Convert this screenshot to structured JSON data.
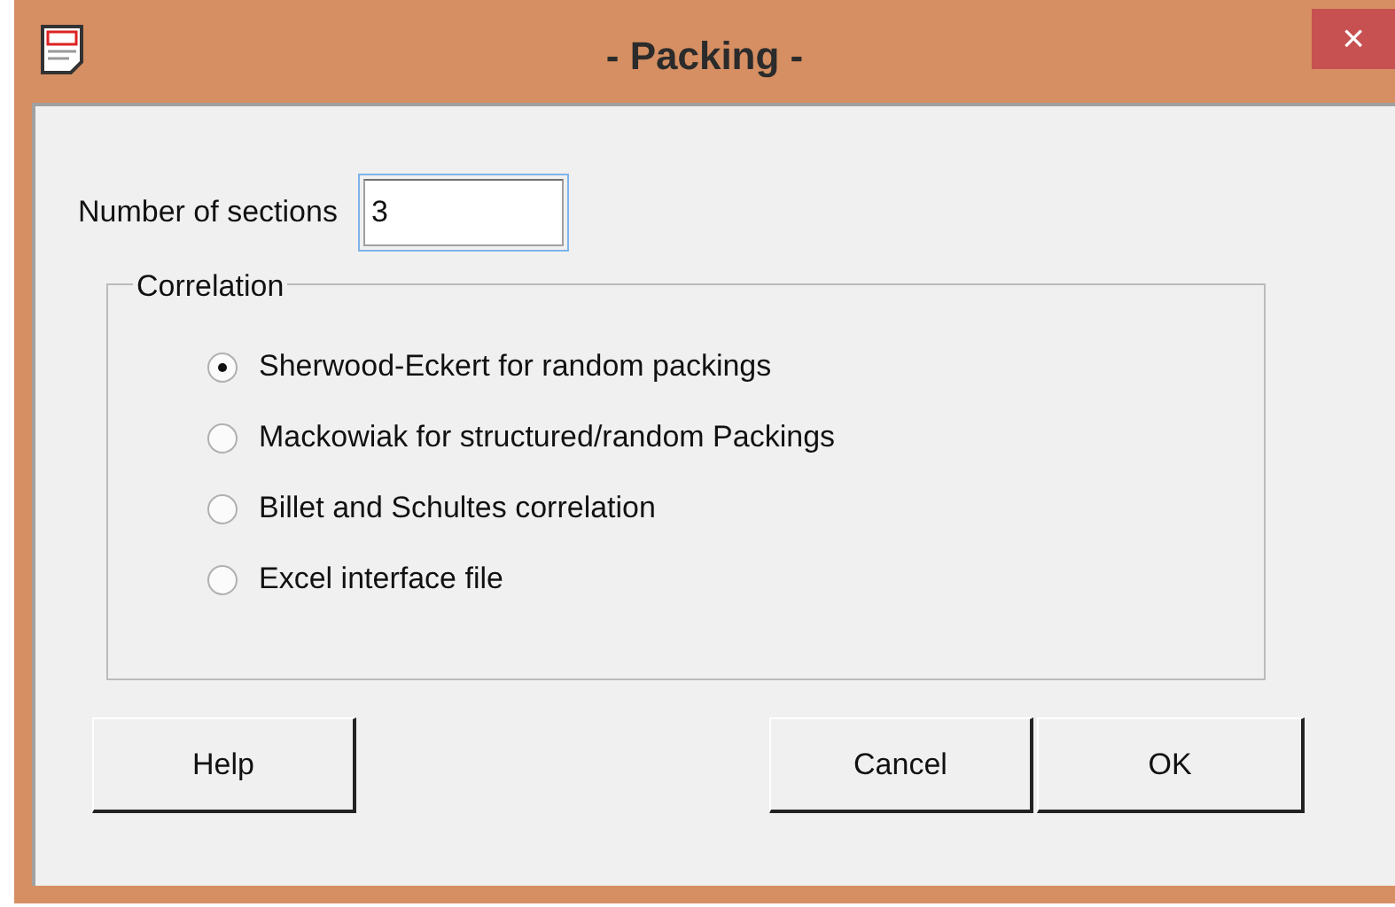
{
  "window": {
    "title": "- Packing -",
    "close": "×"
  },
  "sections": {
    "label": "Number of sections",
    "value": "3"
  },
  "correlation": {
    "title": "Correlation",
    "options": [
      {
        "label": "Sherwood-Eckert for random packings",
        "selected": true
      },
      {
        "label": "Mackowiak for structured/random Packings",
        "selected": false
      },
      {
        "label": "Billet and Schultes correlation",
        "selected": false
      },
      {
        "label": "Excel interface file",
        "selected": false
      }
    ]
  },
  "buttons": {
    "help": "Help",
    "cancel": "Cancel",
    "ok": "OK"
  }
}
